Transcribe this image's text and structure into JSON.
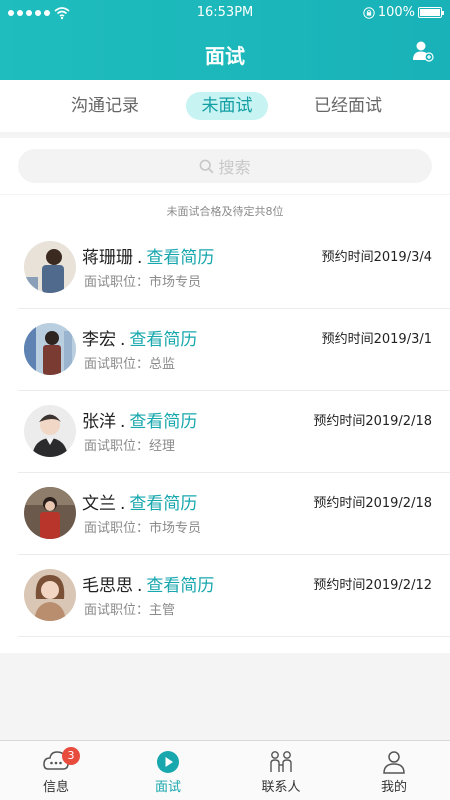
{
  "status_bar": {
    "time": "16:53PM",
    "battery": "100%"
  },
  "header": {
    "title": "面试"
  },
  "tabs": [
    {
      "label": "沟通记录"
    },
    {
      "label": "未面试",
      "active": true
    },
    {
      "label": "已经面试"
    }
  ],
  "search": {
    "placeholder": "搜索"
  },
  "summary": "未面试合格及待定共8位",
  "candidates": [
    {
      "name": "蒋珊珊",
      "sep": ".",
      "link": "查看简历",
      "position": "面试职位：市场专员",
      "time": "预约时间2019/3/4"
    },
    {
      "name": "李宏",
      "sep": ".",
      "link": "查看简历",
      "position": "面试职位：总监",
      "time": "预约时间2019/3/1"
    },
    {
      "name": "张洋",
      "sep": ".",
      "link": "查看简历",
      "position": "面试职位：经理",
      "time": "预约时间2019/2/18"
    },
    {
      "name": "文兰",
      "sep": ".",
      "link": "查看简历",
      "position": "面试职位：市场专员",
      "time": "预约时间2019/2/18"
    },
    {
      "name": "毛思思",
      "sep": ".",
      "link": "查看简历",
      "position": "面试职位：主管",
      "time": "预约时间2019/2/12"
    }
  ],
  "bottom_nav": [
    {
      "label": "信息",
      "icon": "message-icon",
      "badge": "3"
    },
    {
      "label": "面试",
      "icon": "play-circle-icon",
      "active": true
    },
    {
      "label": "联系人",
      "icon": "contacts-icon"
    },
    {
      "label": "我的",
      "icon": "person-icon"
    }
  ],
  "colors": {
    "accent": "#17a7ad",
    "header": "#1fbdbd",
    "badge": "#e74c3c"
  }
}
